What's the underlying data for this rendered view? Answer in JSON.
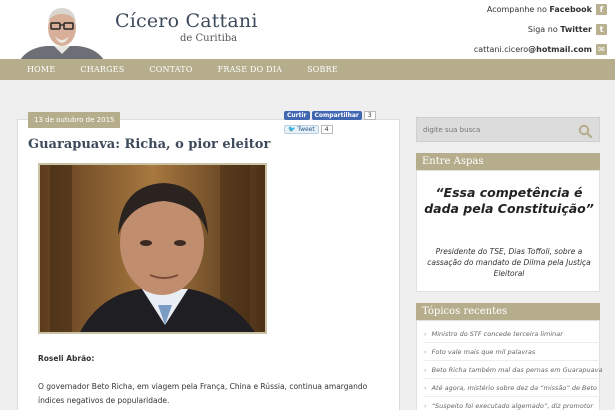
{
  "site": {
    "title": "Cícero Cattani",
    "subtitle": "de Curitiba"
  },
  "social": {
    "facebook_prefix": "Acompanhe no ",
    "facebook_name": "Facebook",
    "twitter_prefix": "Siga no ",
    "twitter_name": "Twitter",
    "email_prefix": "cattani.cicero",
    "email_domain": "@hotmail.com",
    "icon_colors": "#b8b08f"
  },
  "nav": {
    "items": [
      "HOME",
      "CHARGES",
      "CONTATO",
      "FRASE DO DIA",
      "SOBRE"
    ],
    "background": "#b5ad8c"
  },
  "post": {
    "date": "13 de outubro de 2015",
    "fb_like": "Curtir",
    "fb_share": "Compartilhar",
    "fb_count": "3",
    "tweet": "Tweet",
    "tweet_count": "4",
    "title": "Guarapuava: Richa, o pior eleitor",
    "author": "Roseli Abrão:",
    "body": "O governador Beto Richa, em viagem pela França, China e Rússia, continua amargando índices negativos de popularidade."
  },
  "sidebar": {
    "search_placeholder": "digite sua busca",
    "quote_widget_title": "Entre Aspas",
    "quote": "“Essa competência é dada pela Constituição”",
    "quote_source": "Presidente do TSE, Dias Toffoli, sobre a cassação do mandato de Dilma pela Justiça Eleitoral",
    "recent_title": "Tópicos recentes",
    "recent": [
      "Ministro do STF concede terceira liminar",
      "Foto vale mais que mil palavras",
      "Beto Richa também mal das pernas em Guarapuava",
      "Até agora, mistério sobre dez da “missão” de Beto",
      "“Suspeito foi executado algemado”, diz promotor"
    ]
  }
}
